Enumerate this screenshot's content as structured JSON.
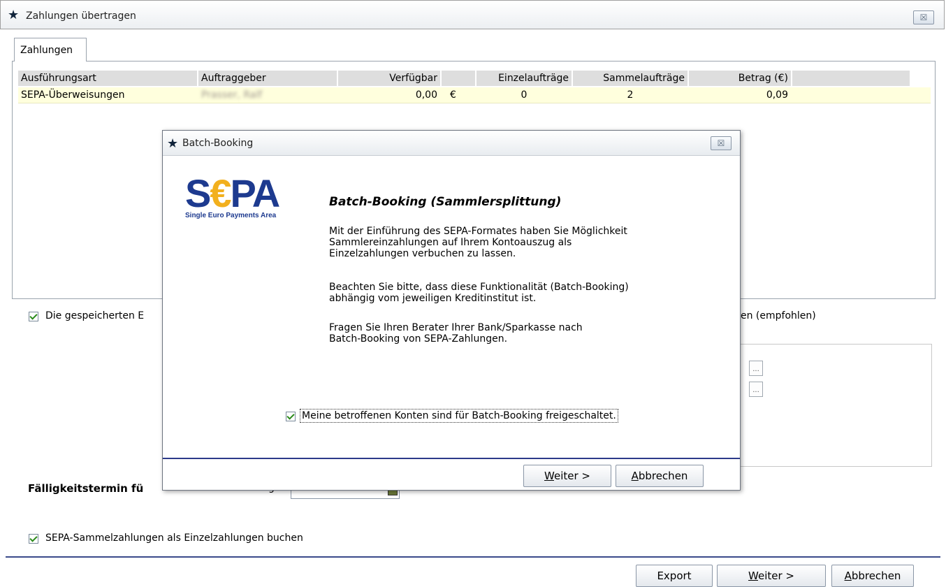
{
  "window": {
    "title": "Zahlungen übertragen",
    "close_glyph": "☒"
  },
  "tabs": [
    {
      "label": "Zahlungen"
    }
  ],
  "grid": {
    "headers": [
      "Ausführungsart",
      "Auftraggeber",
      "Verfügbar",
      "",
      "Einzelaufträge",
      "Sammelaufträge",
      "Betrag (€)",
      ""
    ],
    "rows": [
      {
        "art": "SEPA-Überweisungen",
        "auftraggeber": "Prasser, Ralf",
        "verfuegbar": "0,00",
        "currency": "€",
        "einzel": "0",
        "sammel": "2",
        "betrag": "0,09"
      }
    ]
  },
  "options": {
    "gespeichert_left": "Die gespeicherten E",
    "gespeichert_right": "en (empfohlen)",
    "ellipsis": "..."
  },
  "faelligkeit": {
    "label": "Fälligkeitstermin fü",
    "partial": "g"
  },
  "sammelzahlungen": {
    "label": "SEPA-Sammelzahlungen als Einzelzahlungen buchen"
  },
  "footer": {
    "export": "Export",
    "weiter": "eiter >",
    "weiter_accel": "W",
    "abbrechen": "bbrechen",
    "abbrechen_accel": "A"
  },
  "dialog": {
    "title": "Batch-Booking",
    "logo_word_s": "S",
    "logo_word_euro": "€",
    "logo_word_pa": "PA",
    "logo_sub": "Single Euro Payments Area",
    "heading": "Batch-Booking (Sammlersplittung)",
    "para1": "Mit der Einführung des SEPA-Formates haben Sie Möglichkeit\nSammlereinzahlungen auf Ihrem Kontoauszug als\nEinzelzahlungen verbuchen zu lassen.",
    "para2": "Beachten Sie bitte, dass diese Funktionalität (Batch-Booking)\nabhängig vom jeweiligen Kreditinstitut ist.",
    "para3": "Fragen Sie Ihren Berater Ihrer Bank/Sparkasse nach\nBatch-Booking von SEPA-Zahlungen.",
    "checkbox_label": "Meine betroffenen Konten sind für Batch-Booking freigeschaltet.",
    "weiter": "eiter >",
    "weiter_accel": "W",
    "abbrechen": "bbrechen",
    "abbrechen_accel": "A"
  }
}
